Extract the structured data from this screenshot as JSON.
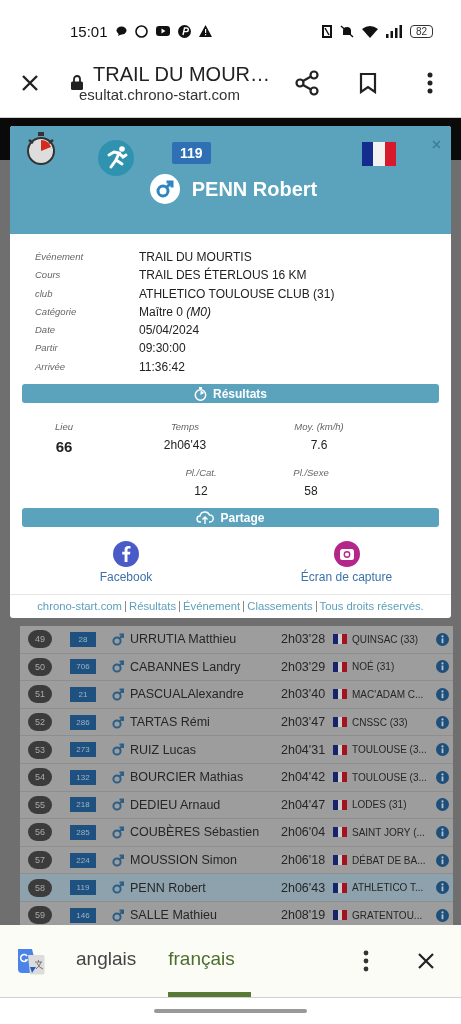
{
  "status_bar": {
    "time": "15:01",
    "battery": "82"
  },
  "browser": {
    "title": "TRAIL DU MOUR…",
    "url": "esultat.chrono-start.com"
  },
  "modal": {
    "bib": "119",
    "name": "PENN Robert",
    "details": [
      {
        "label": "Événement",
        "value": "TRAIL DU MOURTIS"
      },
      {
        "label": "Cours",
        "value": "TRAIL DES ÉTERLOUS 16 KM"
      },
      {
        "label": "club",
        "value": "ATHLETICO TOULOUSE CLUB (31)"
      },
      {
        "label": "Catégorie",
        "value": "Maître 0 *(M0)*"
      },
      {
        "label": "Date",
        "value": "05/04/2024"
      },
      {
        "label": "Partir",
        "value": "09:30:00"
      },
      {
        "label": "Arrivée",
        "value": "11:36:42"
      }
    ],
    "results_title": "Résultats",
    "stats": [
      [
        {
          "label": "Lieu",
          "value": "66",
          "bold": true
        },
        {
          "label": "Temps",
          "value": "2h06'43",
          "bold": false
        },
        {
          "label": "Moy. (km/h)",
          "value": "7.6",
          "bold": false
        }
      ],
      [
        {
          "label": "Pl./Cat.",
          "value": "12",
          "bold": false
        },
        {
          "label": "Pl./Sexe",
          "value": "58",
          "bold": false
        }
      ]
    ],
    "share_title": "Partage",
    "share_buttons": [
      {
        "kind": "facebook",
        "label": "Facebook"
      },
      {
        "kind": "screenshot",
        "label": "Écran de capture"
      }
    ],
    "footer_links": [
      "chrono-start.com",
      "Résultats",
      "Événement",
      "Classements",
      "Tous droits réservés."
    ]
  },
  "table": {
    "rows": [
      {
        "rank": "49",
        "bib": "28",
        "name": "URRUTIA Matthieu",
        "time": "2h03'28",
        "club": "QUINSAC (33)",
        "selected": false
      },
      {
        "rank": "50",
        "bib": "706",
        "name": "CABANNES Landry",
        "time": "2h03'29",
        "club": "NOÉ (31)",
        "selected": false
      },
      {
        "rank": "51",
        "bib": "21",
        "name": "PASCUALAlexandre",
        "time": "2h03'40",
        "club": "MAC'ADAM C...",
        "selected": false
      },
      {
        "rank": "52",
        "bib": "286",
        "name": "TARTAS Rémi",
        "time": "2h03'47",
        "club": "CNSSC (33)",
        "selected": false
      },
      {
        "rank": "53",
        "bib": "273",
        "name": "RUIZ Lucas",
        "time": "2h04'31",
        "club": "TOULOUSE (3...",
        "selected": false
      },
      {
        "rank": "54",
        "bib": "132",
        "name": "BOURCIER Mathias",
        "time": "2h04'42",
        "club": "TOULOUSE (3...",
        "selected": false
      },
      {
        "rank": "55",
        "bib": "218",
        "name": "DEDIEU Arnaud",
        "time": "2h04'47",
        "club": "LODES (31)",
        "selected": false
      },
      {
        "rank": "56",
        "bib": "285",
        "name": "COUBÈRES Sébastien",
        "time": "2h06'04",
        "club": "SAINT JORY (...",
        "selected": false
      },
      {
        "rank": "57",
        "bib": "224",
        "name": "MOUSSION Simon",
        "time": "2h06'18",
        "club": "DÉBAT DE BA...",
        "selected": false
      },
      {
        "rank": "58",
        "bib": "119",
        "name": "PENN Robert",
        "time": "2h06'43",
        "club": "ATHLETICO T...",
        "selected": true
      },
      {
        "rank": "59",
        "bib": "146",
        "name": "SALLE Mathieu",
        "time": "2h08'19",
        "club": "GRATENTOU...",
        "selected": false
      }
    ]
  },
  "translate_bar": {
    "languages": [
      {
        "label": "anglais",
        "selected": false
      },
      {
        "label": "français",
        "selected": true
      }
    ]
  }
}
